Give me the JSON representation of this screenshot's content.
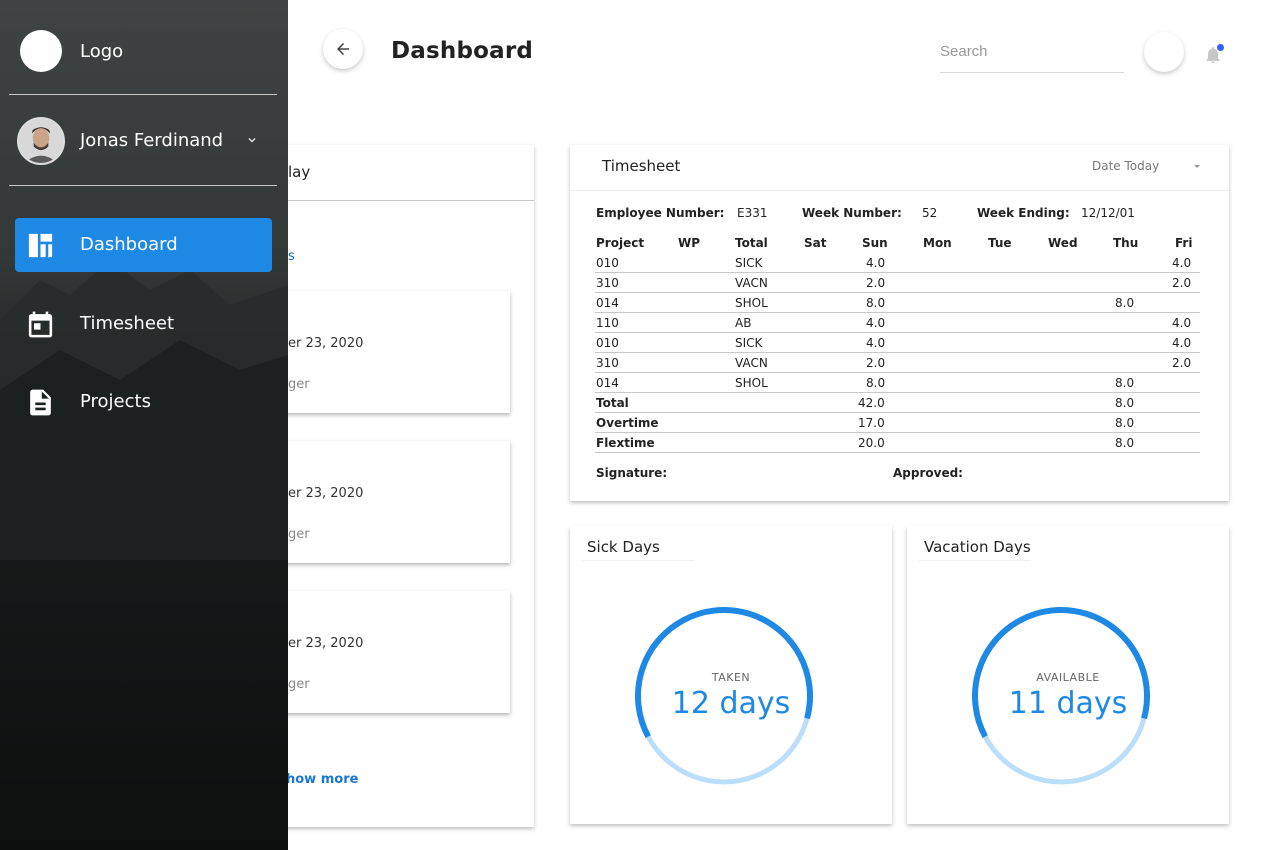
{
  "header": {
    "title": "Dashboard",
    "search_placeholder": "Search"
  },
  "sidebar": {
    "logo_text": "Logo",
    "user_name": "Jonas Ferdinand",
    "items": [
      {
        "label": "Dashboard",
        "icon": "dashboard-icon",
        "active": true
      },
      {
        "label": "Timesheet",
        "icon": "calendar-icon",
        "active": false
      },
      {
        "label": "Projects",
        "icon": "document-icon",
        "active": false
      }
    ]
  },
  "left_card": {
    "header_partial": "lay",
    "subheader_partial": "s",
    "entries": [
      {
        "date_partial": "er 23, 2020",
        "role_partial": "ger"
      },
      {
        "date_partial": "er 23, 2020",
        "role_partial": "ger"
      },
      {
        "date_partial": "er 23, 2020",
        "role_partial": "ger"
      }
    ],
    "show_more_partial": "how more"
  },
  "timesheet": {
    "title": "Timesheet",
    "date_filter": "Date Today",
    "employee_number_label": "Employee Number:",
    "employee_number": "E331",
    "week_number_label": "Week Number:",
    "week_number": "52",
    "week_ending_label": "Week Ending:",
    "week_ending": "12/12/01",
    "columns": [
      "Project",
      "WP",
      "Total",
      "Sat",
      "Sun",
      "Mon",
      "Tue",
      "Wed",
      "Thu",
      "Fri"
    ],
    "rows": [
      {
        "project": "010",
        "total": "SICK",
        "sun": "4.0",
        "thu": "",
        "fri": "4.0"
      },
      {
        "project": "310",
        "total": "VACN",
        "sun": "2.0",
        "thu": "",
        "fri": "2.0"
      },
      {
        "project": "014",
        "total": "SHOL",
        "sun": "8.0",
        "thu": "8.0",
        "fri": ""
      },
      {
        "project": "110",
        "total": "AB",
        "sun": "4.0",
        "thu": "",
        "fri": "4.0"
      },
      {
        "project": "010",
        "total": "SICK",
        "sun": "4.0",
        "thu": "",
        "fri": "4.0"
      },
      {
        "project": "310",
        "total": "VACN",
        "sun": "2.0",
        "thu": "",
        "fri": "2.0"
      },
      {
        "project": "014",
        "total": "SHOL",
        "sun": "8.0",
        "thu": "8.0",
        "fri": ""
      }
    ],
    "summary": [
      {
        "label": "Total",
        "sun": "42.0",
        "thu": "8.0"
      },
      {
        "label": "Overtime",
        "sun": "17.0",
        "thu": "8.0"
      },
      {
        "label": "Flextime",
        "sun": "20.0",
        "thu": "8.0"
      }
    ],
    "signature_label": "Signature:",
    "approved_label": "Approved:"
  },
  "sick_days": {
    "title": "Sick Days",
    "label": "TAKEN",
    "value": "12 days",
    "progress": 0.62
  },
  "vacation_days": {
    "title": "Vacation Days",
    "label": "AVAILABLE",
    "value": "11 days",
    "progress": 0.62
  },
  "colors": {
    "accent": "#1e88e5",
    "gauge_track": "#bbdefb",
    "notification_dot": "#3d5afe"
  }
}
